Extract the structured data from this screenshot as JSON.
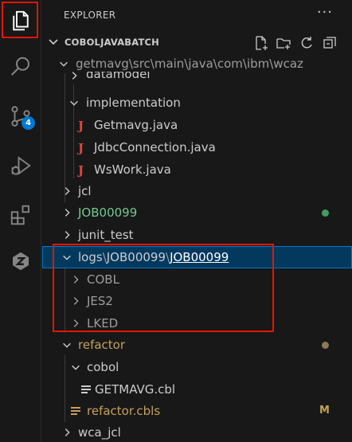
{
  "activity_bar": {
    "items": [
      {
        "name": "explorer-icon",
        "active": true
      },
      {
        "name": "search-icon"
      },
      {
        "name": "source-control-icon",
        "badge": "4"
      },
      {
        "name": "run-debug-icon"
      },
      {
        "name": "extensions-icon"
      },
      {
        "name": "zowe-icon"
      }
    ]
  },
  "sidebar": {
    "title": "EXPLORER",
    "more_actions": "···",
    "section": {
      "title": "COBOLJAVABATCH",
      "tools": [
        "new-file-icon",
        "new-folder-icon",
        "refresh-icon",
        "collapse-all-icon"
      ]
    },
    "tree": {
      "compact_path": "getmavg\\src\\main\\java\\com\\ibm\\wcaz",
      "datamodel": "datamodel",
      "implementation": "implementation",
      "files_java": [
        "Getmavg.java",
        "JdbcConnection.java",
        "WsWork.java"
      ],
      "jcl": "jcl",
      "job": "JOB00099",
      "junit": "junit_test",
      "logs_path": [
        "logs",
        "JOB00099",
        "JOB00099"
      ],
      "logs_children": [
        "COBL",
        "JES2",
        "LKED"
      ],
      "refactor": "refactor",
      "cobol": "cobol",
      "cbl_file": "GETMAVG.cbl",
      "cbls_file": "refactor.cbls",
      "cbls_status": "M",
      "wca_jcl": "wca_jcl"
    },
    "colors": {
      "job_green": "#73c991",
      "modified_gold": "#c5a15a",
      "selection": "#04395e",
      "highlight_red": "#e51400"
    }
  }
}
